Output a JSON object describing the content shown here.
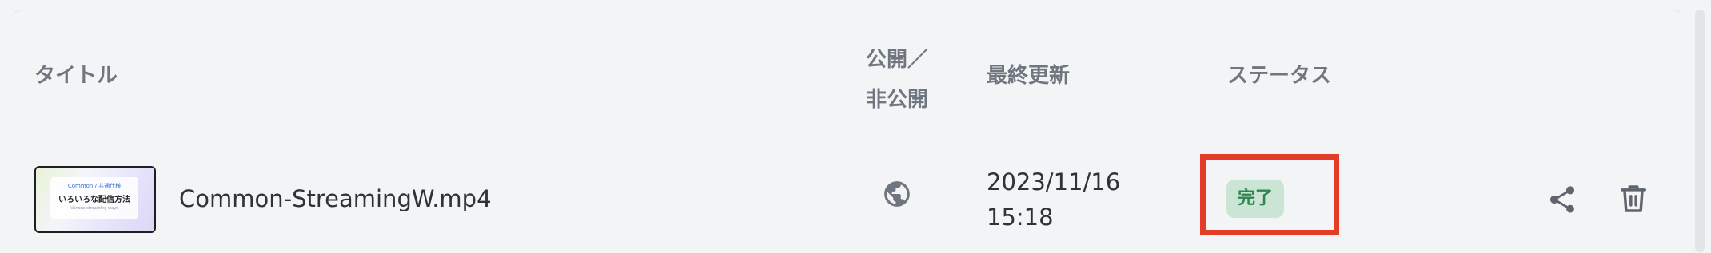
{
  "table": {
    "headers": {
      "title": "タイトル",
      "public_line1": "公開／",
      "public_line2": "非公開",
      "updated": "最終更新",
      "status": "ステータス"
    },
    "rows": [
      {
        "thumbnail": {
          "line1": "Common / 共通仕様",
          "line2": "いろいろな配信方法",
          "line3": "Various streaming ways"
        },
        "filename": "Common-StreamingW.mp4",
        "visibility_icon": "globe-icon",
        "updated_date": "2023/11/16",
        "updated_time": "15:18",
        "status": "完了",
        "actions": [
          "share-icon",
          "trash-icon"
        ]
      }
    ]
  },
  "colors": {
    "highlight_border": "#e33d27",
    "badge_bg": "#cbe5d4",
    "badge_text": "#2e8550",
    "header_text": "#707680"
  }
}
